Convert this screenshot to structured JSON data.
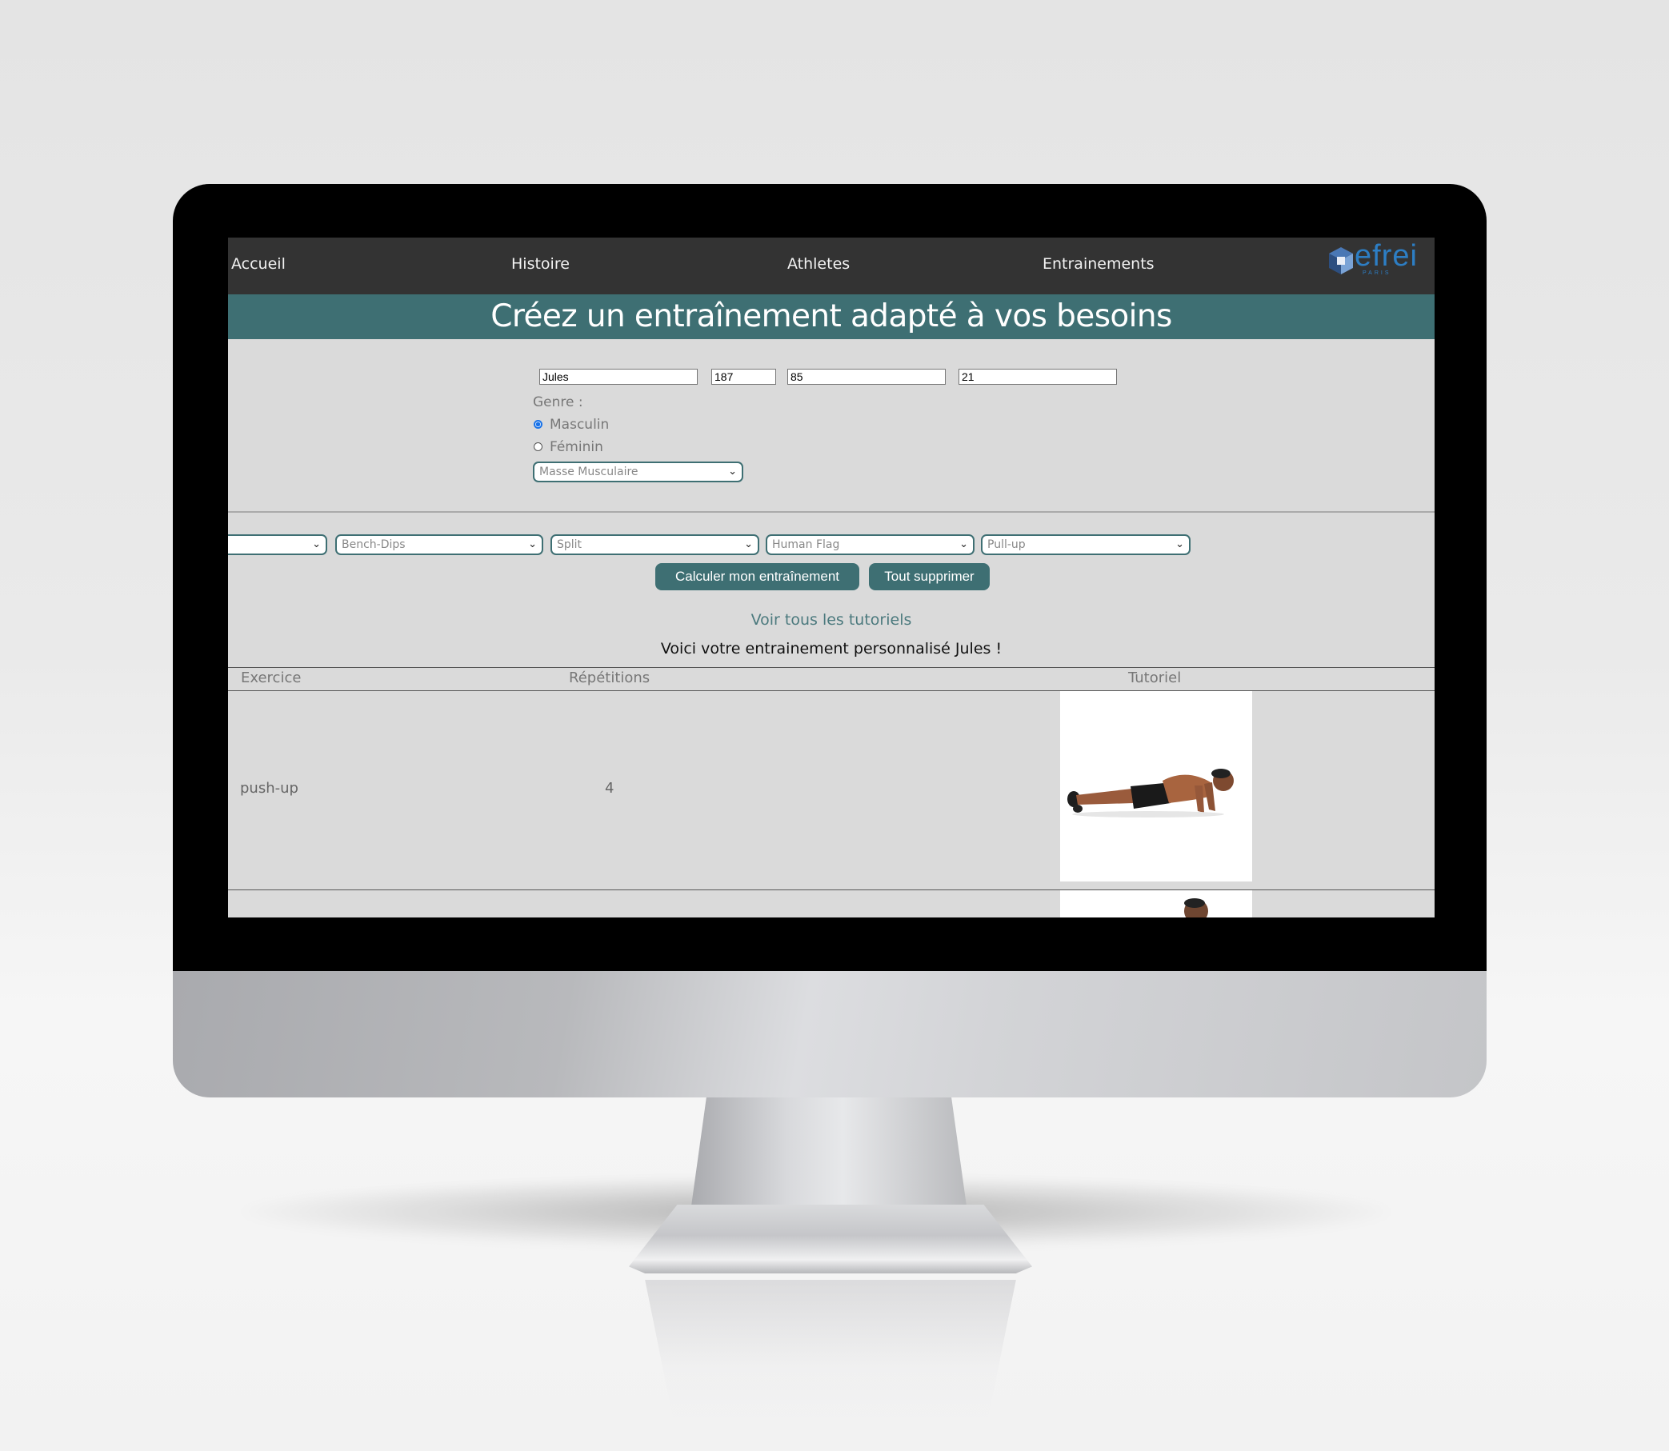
{
  "nav": {
    "items": [
      {
        "label": "Accueil"
      },
      {
        "label": "Histoire"
      },
      {
        "label": "Athletes"
      },
      {
        "label": "Entrainements"
      }
    ],
    "logo_text": "efrei",
    "logo_sub": "PARIS"
  },
  "banner": {
    "title": "Créez un entraînement adapté à vos besoins"
  },
  "form": {
    "name_value": "Jules",
    "height_value": "187",
    "weight_value": "85",
    "age_value": "21",
    "gender_label": "Genre :",
    "gender_options": [
      "Masculin",
      "Féminin"
    ],
    "gender_selected": "Masculin",
    "goal_selected": "Masse Musculaire"
  },
  "exercise_selects": [
    "",
    "Bench-Dips",
    "Split",
    "Human Flag",
    "Pull-up"
  ],
  "actions": {
    "calculate_label": "Calculer mon entraînement",
    "clear_label": "Tout supprimer",
    "tutorials_link": "Voir tous les tutoriels",
    "result_message": "Voici votre entrainement personnalisé Jules !"
  },
  "table": {
    "headers": [
      "Exercice",
      "Répétitions",
      "Tutoriel"
    ],
    "rows": [
      {
        "exercise": "push-up",
        "reps": "4",
        "tutorial_image": "push-up-photo"
      }
    ]
  },
  "colors": {
    "nav_bg": "#333333",
    "accent": "#3e6f73",
    "page_bg": "#dadada",
    "logo_blue": "#2d7ec4"
  }
}
